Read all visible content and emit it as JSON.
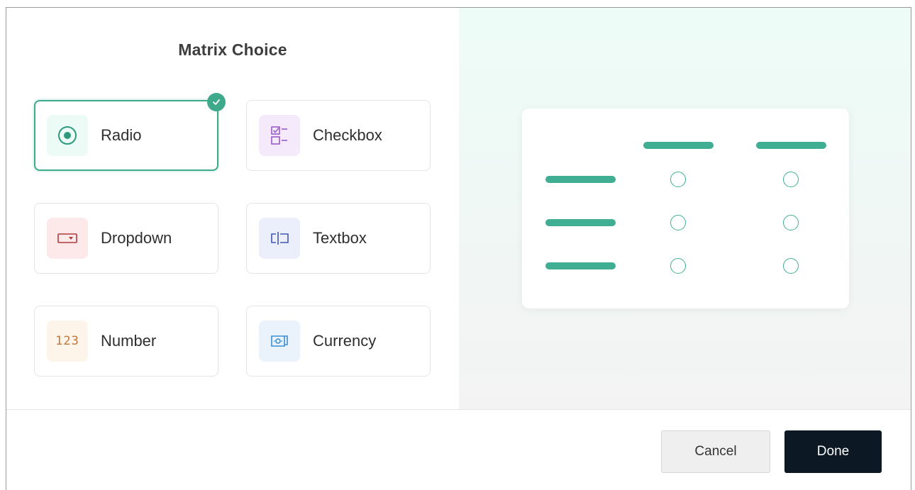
{
  "dialog": {
    "title": "Matrix Choice",
    "options": [
      {
        "id": "radio",
        "label": "Radio",
        "icon": "radio-icon",
        "selected": true,
        "icon_bg": "#ecfbf5",
        "icon_color": "#2d9a7d"
      },
      {
        "id": "checkbox",
        "label": "Checkbox",
        "icon": "checkbox-list-icon",
        "selected": false,
        "icon_bg": "#f4eafb",
        "icon_color": "#9a5cc7"
      },
      {
        "id": "dropdown",
        "label": "Dropdown",
        "icon": "dropdown-icon",
        "selected": false,
        "icon_bg": "#fde9ea",
        "icon_color": "#b23a3a"
      },
      {
        "id": "textbox",
        "label": "Textbox",
        "icon": "textbox-icon",
        "selected": false,
        "icon_bg": "#ebeefb",
        "icon_color": "#4257b5"
      },
      {
        "id": "number",
        "label": "Number",
        "icon": "number-icon",
        "icon_text": "123",
        "selected": false,
        "icon_bg": "#fdf5ea",
        "icon_color": "#c2773a"
      },
      {
        "id": "currency",
        "label": "Currency",
        "icon": "currency-icon",
        "selected": false,
        "icon_bg": "#eaf2fc",
        "icon_color": "#3b8fd0"
      }
    ],
    "accent_color": "#3fa98c"
  },
  "footer": {
    "cancel_label": "Cancel",
    "done_label": "Done"
  }
}
